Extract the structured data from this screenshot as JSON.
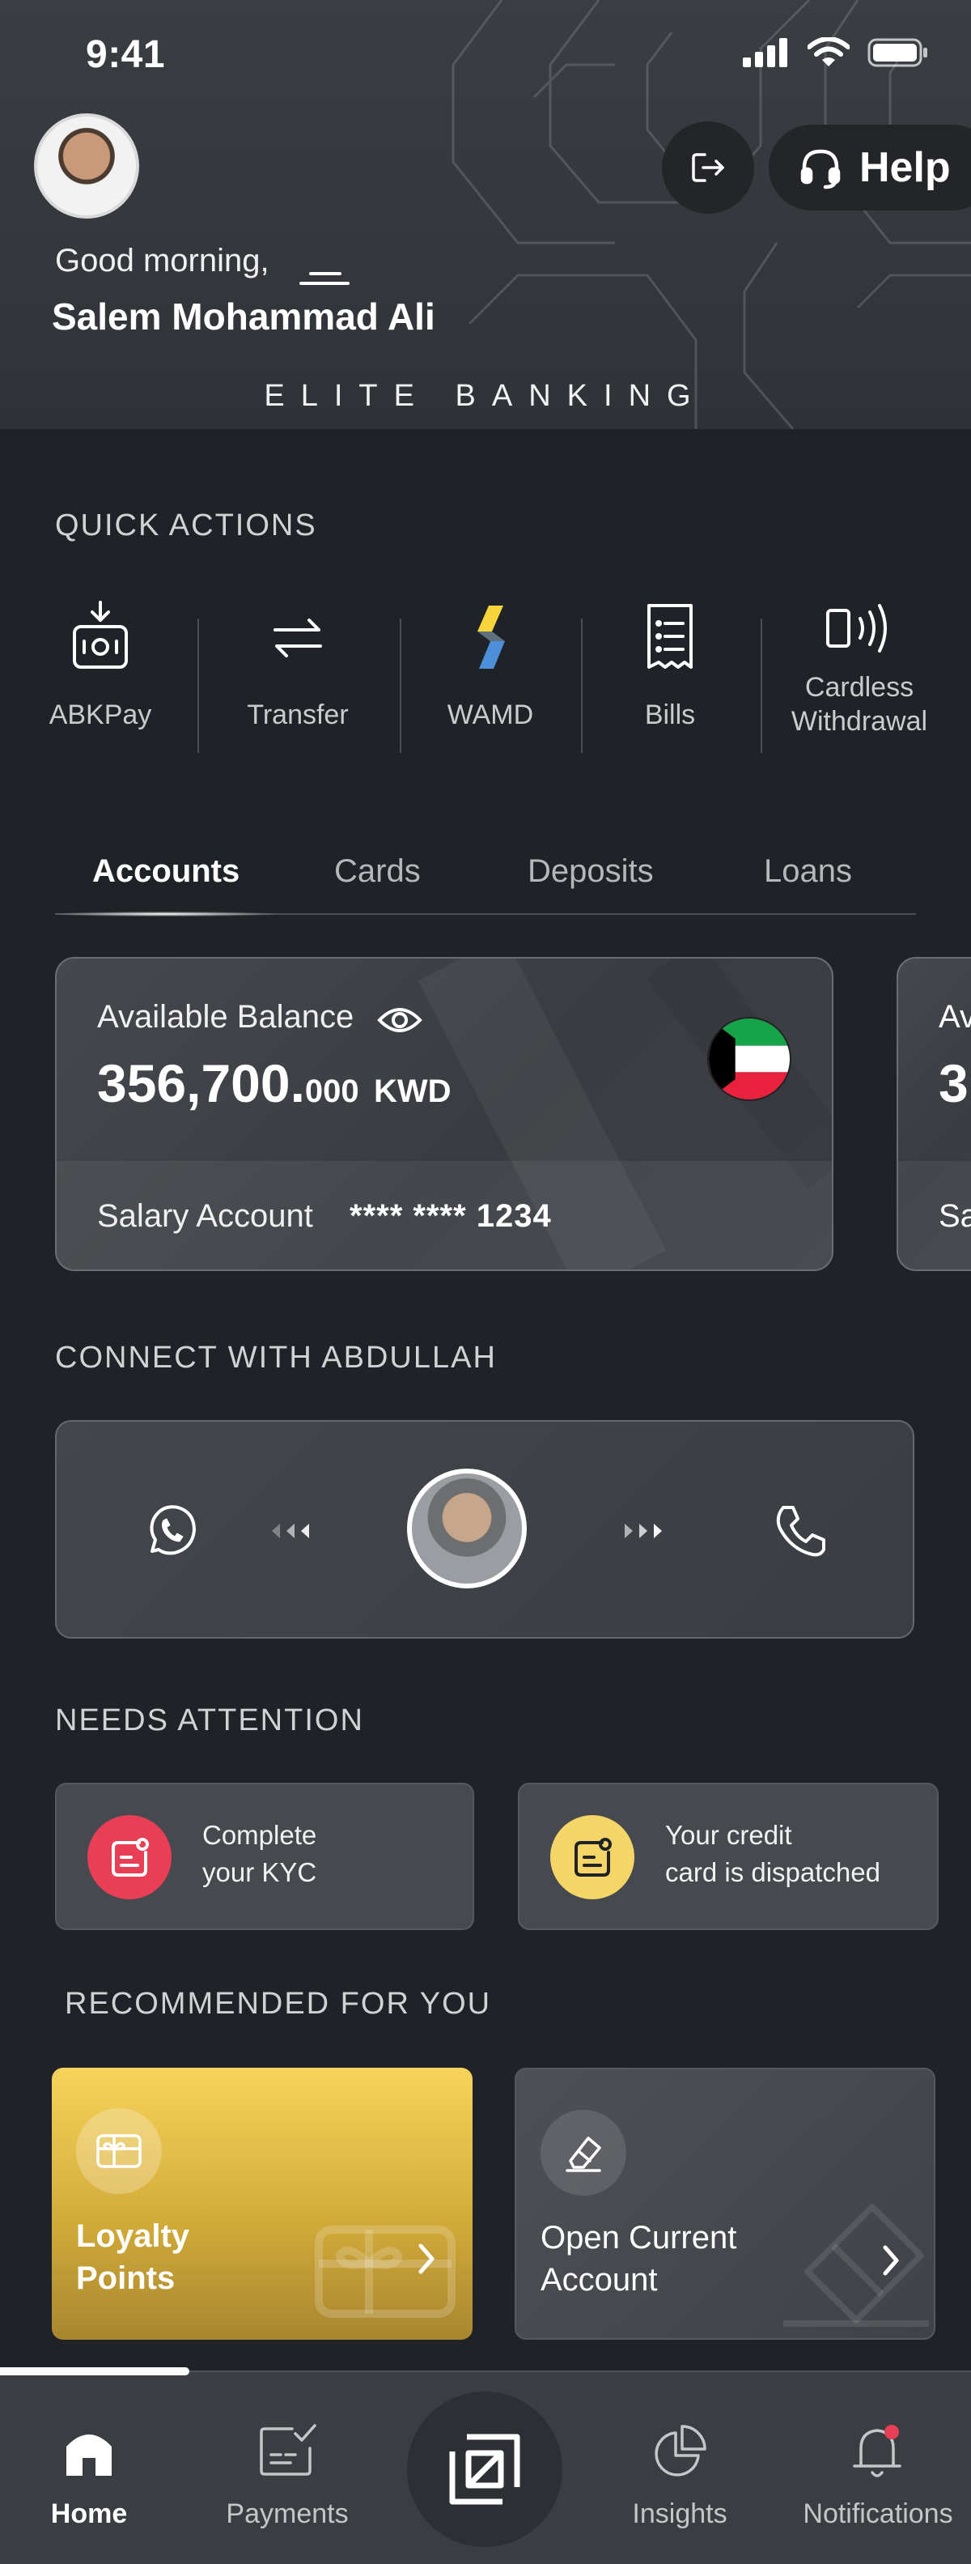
{
  "status_bar": {
    "time": "9:41"
  },
  "header": {
    "greeting": "Good morning,",
    "user_name": "Salem Mohammad Ali",
    "tier": "ELITE BANKING",
    "help_label": "Help"
  },
  "quick_actions": {
    "title": "QUICK ACTIONS",
    "items": [
      {
        "label": "ABKPay",
        "icon": "abkpay-icon"
      },
      {
        "label": "Transfer",
        "icon": "transfer-icon"
      },
      {
        "label": "WAMD",
        "icon": "wamd-icon"
      },
      {
        "label": "Bills",
        "icon": "bills-icon"
      },
      {
        "label_line1": "Cardless",
        "label_line2": "Withdrawal",
        "icon": "cardless-withdrawal-icon"
      }
    ]
  },
  "tabs": [
    {
      "label": "Accounts",
      "active": true
    },
    {
      "label": "Cards",
      "active": false
    },
    {
      "label": "Deposits",
      "active": false
    },
    {
      "label": "Loans",
      "active": false
    }
  ],
  "account_card": {
    "available_label": "Available Balance",
    "balance_main": "356,700.",
    "balance_decimals": "000",
    "currency": "KWD",
    "account_name": "Salary Account",
    "account_number": "**** **** 1234",
    "peek_label": "Av",
    "peek_balance": "3",
    "peek_account": "Sa"
  },
  "connect": {
    "title": "CONNECT WITH ABDULLAH"
  },
  "attention": {
    "title": "NEEDS ATTENTION",
    "items": [
      {
        "line1": "Complete",
        "line2": "your KYC",
        "color": "#e83e56"
      },
      {
        "line1": "Your credit",
        "line2": "card is dispatched",
        "color": "#f5d567"
      }
    ]
  },
  "recommended": {
    "title": "RECOMMENDED FOR YOU",
    "items": [
      {
        "line1": "Loyalty",
        "line2": "Points"
      },
      {
        "line1": "Open Current",
        "line2": "Account"
      }
    ]
  },
  "bottom_nav": [
    {
      "label": "Home",
      "active": true
    },
    {
      "label": "Payments",
      "active": false
    },
    {
      "label": "Insights",
      "active": false
    },
    {
      "label": "Notifications",
      "active": false
    }
  ],
  "colors": {
    "accent_red": "#e83e56",
    "accent_yellow": "#f5d567",
    "background": "#1f2226"
  }
}
